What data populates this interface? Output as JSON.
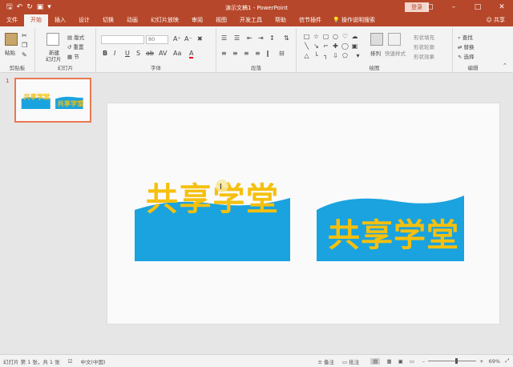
{
  "window": {
    "doc_title": "演示文稿1",
    "app_name": "PowerPoint",
    "separator": "-",
    "login_label": "登录"
  },
  "quick_access": {
    "save_icon": "save-icon",
    "undo_icon": "undo-icon",
    "redo_icon": "redo-icon",
    "start_icon": "start-from-beginning-icon",
    "customize_icon": "customize-icon"
  },
  "tabs": [
    {
      "label": "文件",
      "active": false
    },
    {
      "label": "开始",
      "active": true
    },
    {
      "label": "插入",
      "active": false
    },
    {
      "label": "设计",
      "active": false
    },
    {
      "label": "切换",
      "active": false
    },
    {
      "label": "动画",
      "active": false
    },
    {
      "label": "幻灯片放映",
      "active": false
    },
    {
      "label": "审阅",
      "active": false
    },
    {
      "label": "视图",
      "active": false
    },
    {
      "label": "开发工具",
      "active": false
    },
    {
      "label": "帮助",
      "active": false
    },
    {
      "label": "信节插件",
      "active": false
    }
  ],
  "tell_me": "操作说明搜索",
  "share_label": "共享",
  "ribbon": {
    "clipboard": {
      "label": "剪贴板",
      "paste": "粘贴"
    },
    "slides": {
      "label": "幻灯片",
      "new_slide": "新建",
      "new_slide2": "幻灯片",
      "layout": "版式",
      "reset": "重置",
      "section": "节"
    },
    "font": {
      "label": "字体",
      "size": "80",
      "buttons": [
        "B",
        "I",
        "U",
        "S",
        "ab",
        "AV",
        "Aa",
        "A"
      ]
    },
    "paragraph": {
      "label": "段落"
    },
    "drawing": {
      "label": "绘图",
      "arrange": "排列",
      "quick_styles": "快速样式",
      "fill": "形状填充",
      "outline": "形状轮廓",
      "effects": "形状效果"
    },
    "editing": {
      "label": "编辑",
      "find": "查找",
      "replace": "替换",
      "select": "选择"
    }
  },
  "slide": {
    "number": "1",
    "text_left": "共享学堂",
    "text_right": "共享学堂",
    "colors": {
      "blue": "#1aa3df",
      "yellow": "#f5c00e"
    }
  },
  "status": {
    "slide_info": "幻灯片 第 1 张，共 1 张",
    "language": "中文(中国)",
    "notes": "备注",
    "comments": "批注",
    "zoom": "69%"
  },
  "colors": {
    "accent": "#b7472a"
  }
}
